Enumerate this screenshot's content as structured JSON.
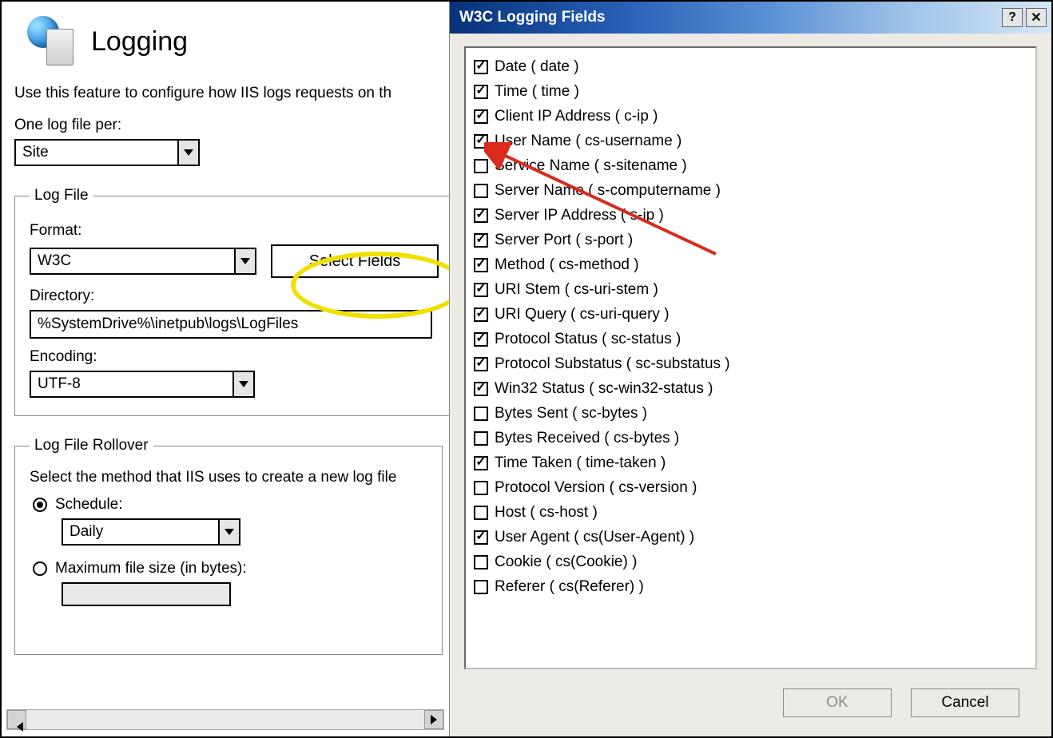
{
  "left": {
    "title": "Logging",
    "instruction": "Use this feature to configure how IIS logs requests on th",
    "one_log_label": "One log file per:",
    "one_log_value": "Site",
    "logfile": {
      "legend": "Log File",
      "format_label": "Format:",
      "format_value": "W3C",
      "select_fields_btn": "Select Fields",
      "directory_label": "Directory:",
      "directory_value": "%SystemDrive%\\inetpub\\logs\\LogFiles",
      "encoding_label": "Encoding:",
      "encoding_value": "UTF-8"
    },
    "rollover": {
      "legend": "Log File Rollover",
      "instruction": "Select the method that IIS uses to create a new log file",
      "schedule_label": "Schedule:",
      "schedule_value": "Daily",
      "maxsize_label": "Maximum file size (in bytes):"
    }
  },
  "dialog": {
    "title": "W3C Logging Fields",
    "ok": "OK",
    "cancel": "Cancel",
    "fields": [
      {
        "label": "Date ( date )",
        "checked": true
      },
      {
        "label": "Time ( time )",
        "checked": true
      },
      {
        "label": "Client IP Address ( c-ip )",
        "checked": true
      },
      {
        "label": "User Name ( cs-username )",
        "checked": true
      },
      {
        "label": "Service Name ( s-sitename )",
        "checked": false
      },
      {
        "label": "Server Name ( s-computername )",
        "checked": false
      },
      {
        "label": "Server IP Address ( s-ip )",
        "checked": true
      },
      {
        "label": "Server Port ( s-port )",
        "checked": true
      },
      {
        "label": "Method ( cs-method )",
        "checked": true
      },
      {
        "label": "URI Stem ( cs-uri-stem )",
        "checked": true
      },
      {
        "label": "URI Query ( cs-uri-query )",
        "checked": true
      },
      {
        "label": "Protocol Status ( sc-status )",
        "checked": true
      },
      {
        "label": "Protocol Substatus ( sc-substatus )",
        "checked": true
      },
      {
        "label": "Win32 Status ( sc-win32-status )",
        "checked": true
      },
      {
        "label": "Bytes Sent ( sc-bytes )",
        "checked": false
      },
      {
        "label": "Bytes Received ( cs-bytes )",
        "checked": false
      },
      {
        "label": "Time Taken ( time-taken )",
        "checked": true
      },
      {
        "label": "Protocol Version ( cs-version )",
        "checked": false
      },
      {
        "label": "Host ( cs-host )",
        "checked": false
      },
      {
        "label": "User Agent ( cs(User-Agent) )",
        "checked": true
      },
      {
        "label": "Cookie ( cs(Cookie) )",
        "checked": false
      },
      {
        "label": "Referer ( cs(Referer) )",
        "checked": false
      }
    ]
  }
}
